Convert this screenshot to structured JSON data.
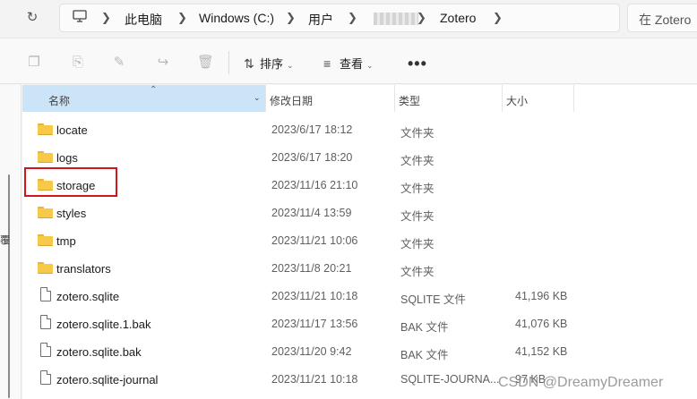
{
  "address_bar": {
    "crumbs": [
      "此电脑",
      "Windows (C:)",
      "用户",
      "Zotero"
    ],
    "search_placeholder": "在 Zotero"
  },
  "toolbar": {
    "sort_label": "排序",
    "view_label": "查看",
    "more_label": "•••"
  },
  "columns": {
    "name": "名称",
    "date": "修改日期",
    "type": "类型",
    "size": "大小"
  },
  "nav_glyph": "覆",
  "files": [
    {
      "name": "locate",
      "date": "2023/6/17 18:12",
      "type": "文件夹",
      "size": "",
      "kind": "folder"
    },
    {
      "name": "logs",
      "date": "2023/6/17 18:20",
      "type": "文件夹",
      "size": "",
      "kind": "folder"
    },
    {
      "name": "storage",
      "date": "2023/11/16 21:10",
      "type": "文件夹",
      "size": "",
      "kind": "folder"
    },
    {
      "name": "styles",
      "date": "2023/11/4 13:59",
      "type": "文件夹",
      "size": "",
      "kind": "folder"
    },
    {
      "name": "tmp",
      "date": "2023/11/21 10:06",
      "type": "文件夹",
      "size": "",
      "kind": "folder"
    },
    {
      "name": "translators",
      "date": "2023/11/8 20:21",
      "type": "文件夹",
      "size": "",
      "kind": "folder"
    },
    {
      "name": "zotero.sqlite",
      "date": "2023/11/21 10:18",
      "type": "SQLITE 文件",
      "size": "41,196 KB",
      "kind": "file"
    },
    {
      "name": "zotero.sqlite.1.bak",
      "date": "2023/11/17 13:56",
      "type": "BAK 文件",
      "size": "41,076 KB",
      "kind": "file"
    },
    {
      "name": "zotero.sqlite.bak",
      "date": "2023/11/20 9:42",
      "type": "BAK 文件",
      "size": "41,152 KB",
      "kind": "file"
    },
    {
      "name": "zotero.sqlite-journal",
      "date": "2023/11/21 10:18",
      "type": "SQLITE-JOURNA...",
      "size": "97 KB",
      "kind": "file"
    }
  ],
  "watermark": "CSDN @DreamyDreamer"
}
